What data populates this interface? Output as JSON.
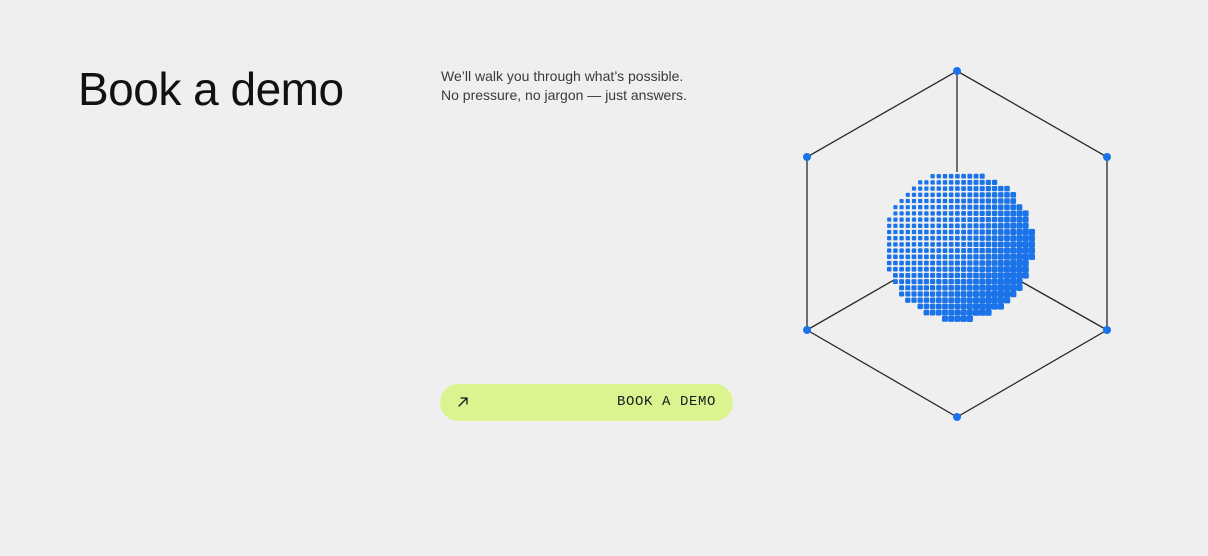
{
  "page": {
    "title": "Book a demo",
    "subtitle_lines": [
      "We’ll walk you through what’s possible.",
      "No pressure, no jargon — just answers."
    ]
  },
  "cta": {
    "label": "BOOK A DEMO",
    "icon": "arrow-up-right-icon",
    "background": "#dcf48f"
  },
  "illustration": {
    "description_icon": "hexagon-cube-wireframe",
    "accent": "#1a73e8",
    "line_color": "#2a2a2a"
  }
}
